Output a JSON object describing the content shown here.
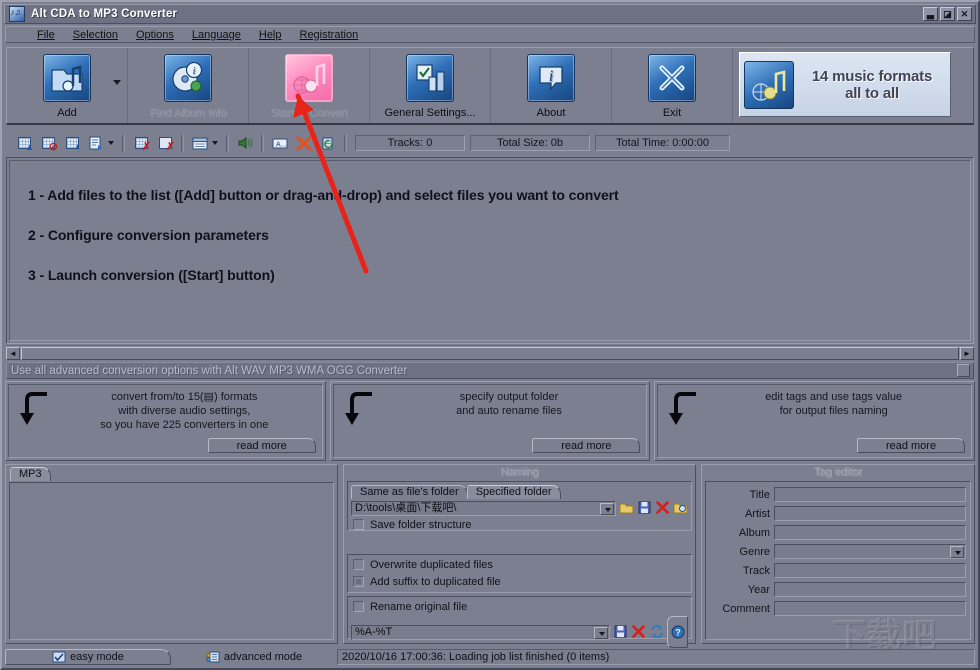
{
  "window": {
    "title": "Alt CDA to MP3 Converter",
    "buttons": {
      "minimize": "▃",
      "maximize": "◪",
      "close": "✕"
    }
  },
  "menu": {
    "items": [
      {
        "label": "File",
        "accel": "F"
      },
      {
        "label": "Selection",
        "accel": "S"
      },
      {
        "label": "Options",
        "accel": "O"
      },
      {
        "label": "Language",
        "accel": "L"
      },
      {
        "label": "Help",
        "accel": "H"
      },
      {
        "label": "Registration",
        "accel": "R"
      }
    ]
  },
  "toolbar": {
    "buttons": [
      {
        "label": "Add",
        "icon": "add-folder-music-icon",
        "enabled": true,
        "has_dropdown": true
      },
      {
        "label": "Find Album Info",
        "icon": "cd-info-icon",
        "enabled": false,
        "has_dropdown": false
      },
      {
        "label": "Start to Convert",
        "icon": "convert-music-icon",
        "enabled": false,
        "has_dropdown": false
      },
      {
        "label": "General Settings...",
        "icon": "settings-icon",
        "enabled": true,
        "has_dropdown": false
      },
      {
        "label": "About",
        "icon": "info-icon",
        "enabled": true,
        "has_dropdown": false
      },
      {
        "label": "Exit",
        "icon": "exit-x-icon",
        "enabled": true,
        "has_dropdown": false
      }
    ],
    "promo": {
      "line1": "14 music formats",
      "line2": "all to all",
      "icon": "music-note-monitor-icon"
    }
  },
  "smallbar": {
    "icons": [
      "select-all-icon",
      "select-none-icon",
      "invert-selection-icon",
      "list-properties-icon",
      "remove-selected-icon",
      "remove-all-icon",
      "view-mode-icon",
      "play-sound-icon",
      "rename-tag-icon",
      "delete-red-x-icon",
      "refresh-list-icon"
    ],
    "stats": [
      {
        "name": "tracks",
        "label": "Tracks: 0"
      },
      {
        "name": "total-size",
        "label": "Total Size: 0b"
      },
      {
        "name": "total-time",
        "label": "Total Time: 0:00:00"
      }
    ]
  },
  "instructions": {
    "steps": [
      "1 - Add files to the list ([Add] button or drag-and-drop) and select files you want to convert",
      "2 - Configure conversion parameters",
      "3 - Launch conversion ([Start] button)"
    ]
  },
  "advert_bar": {
    "text": "Use all advanced conversion options with Alt WAV MP3 WMA OGG Converter"
  },
  "feature_panels": [
    {
      "lines": [
        "convert from/to 15(▤) formats",
        "with diverse audio settings,",
        "so you have 225 converters in one"
      ],
      "button": "read more"
    },
    {
      "lines": [
        "specify output folder",
        "and auto rename files"
      ],
      "button": "read more"
    },
    {
      "lines": [
        "edit tags and use tags value",
        "for output files naming"
      ],
      "button": "read more"
    }
  ],
  "format_panel": {
    "tabs": [
      {
        "label": "MP3",
        "active": true
      }
    ]
  },
  "naming_panel": {
    "title": "Naming",
    "tabs": [
      {
        "label": "Same as file's folder",
        "active": false
      },
      {
        "label": "Specified folder",
        "active": true
      }
    ],
    "folder_path": "D:\\tools\\桌面\\下载吧\\",
    "folder_buttons": [
      "browse-folder-icon",
      "save-icon",
      "delete-red-x-icon",
      "open-folder-icon"
    ],
    "checkboxes": [
      {
        "label": "Save folder structure",
        "checked": false
      },
      {
        "label": "Overwrite duplicated files",
        "checked": false
      },
      {
        "label": "Add suffix to duplicated file",
        "checked": true
      },
      {
        "label": "Rename original file",
        "checked": false
      }
    ],
    "rename_pattern": "%A-%T",
    "rename_buttons": [
      "save-icon",
      "delete-red-x-icon",
      "refresh-icon"
    ],
    "help_button": "?"
  },
  "tag_editor": {
    "title": "Tag editor",
    "fields": [
      {
        "label": "Title",
        "value": "",
        "type": "text"
      },
      {
        "label": "Artist",
        "value": "",
        "type": "text"
      },
      {
        "label": "Album",
        "value": "",
        "type": "text"
      },
      {
        "label": "Genre",
        "value": "",
        "type": "combo"
      },
      {
        "label": "Track",
        "value": "",
        "type": "text"
      },
      {
        "label": "Year",
        "value": "",
        "type": "text"
      },
      {
        "label": "Comment",
        "value": "",
        "type": "text"
      }
    ]
  },
  "statusbar": {
    "easy_mode": "easy mode",
    "advanced_mode": "advanced mode",
    "message": "2020/10/16 17:00:36: Loading job list finished (0 items)"
  },
  "watermark": "下载吧",
  "colors": {
    "face": "#7c7f90",
    "accent_blue": "#2f6fb8",
    "accent_pink": "#ff8ec0",
    "red": "#e03020"
  }
}
